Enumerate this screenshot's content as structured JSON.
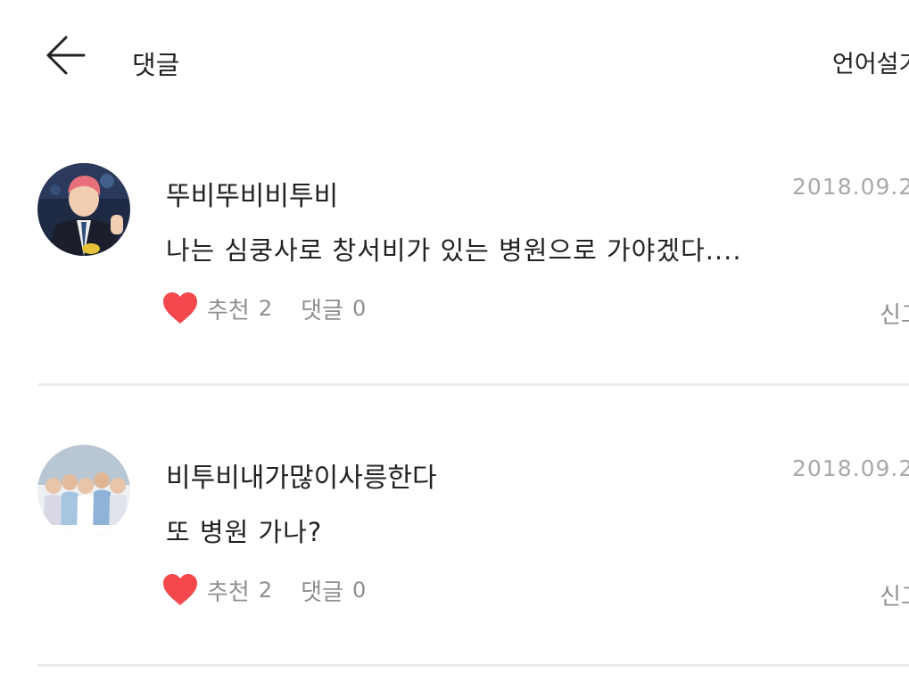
{
  "header": {
    "title": "댓글",
    "language_label": "언어설기"
  },
  "comments": [
    {
      "username": "뚜비뚜비비투비",
      "date": "2018.09.2",
      "text": "나는 심쿵사로 창서비가 있는 병원으로 가야겠다....",
      "like_label": "추천",
      "like_count": "2",
      "reply_label": "댓글",
      "reply_count": "0",
      "report_label": "신고"
    },
    {
      "username": "비투비내가많이사릉한다",
      "date": "2018.09.2",
      "text": "또 병원 가나?",
      "like_label": "추천",
      "like_count": "2",
      "reply_label": "댓글",
      "reply_count": "0",
      "report_label": "신고"
    }
  ],
  "colors": {
    "heart": "#f2484e",
    "muted_text": "#8f8f8f",
    "date_text": "#a9a9a9",
    "divider": "#ececec"
  },
  "icons": {
    "back": "back-arrow-icon",
    "like": "heart-icon"
  }
}
